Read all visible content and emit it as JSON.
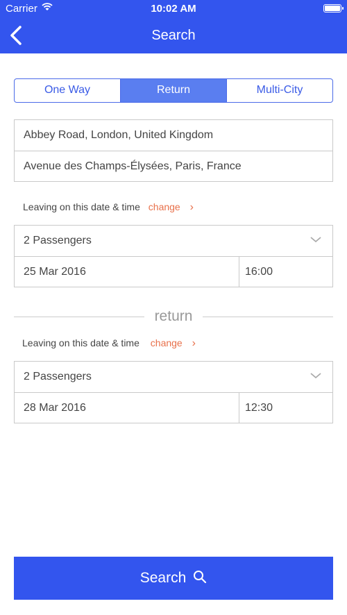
{
  "status": {
    "carrier": "Carrier",
    "time": "10:02 AM"
  },
  "nav": {
    "title": "Search"
  },
  "tabs": [
    {
      "label": "One Way"
    },
    {
      "label": "Return"
    },
    {
      "label": "Multi-City"
    }
  ],
  "route": {
    "from": "Abbey Road, London, United Kingdom",
    "to": "Avenue des Champs-Élysées, Paris, France"
  },
  "outbound": {
    "leaving_text": "Leaving on this date & time",
    "change_label": "change",
    "passengers": "2 Passengers",
    "date": "25 Mar 2016",
    "time": "16:00"
  },
  "return_label": "return",
  "inbound": {
    "leaving_text": "Leaving on this date & time",
    "change_label": "change",
    "passengers": "2 Passengers",
    "date": "28 Mar 2016",
    "time": "12:30"
  },
  "search_button": {
    "label": "Search"
  },
  "colors": {
    "primary": "#3355ee",
    "accent": "#e8704a"
  }
}
